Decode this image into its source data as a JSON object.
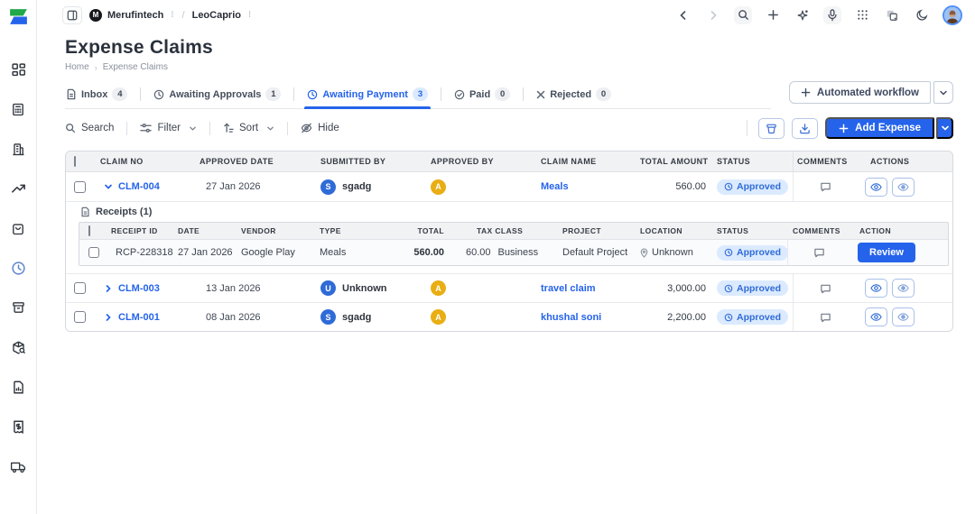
{
  "topbar": {
    "org_name": "Merufintech",
    "path_separator": "/",
    "project_name": "LeoCaprio"
  },
  "page": {
    "title": "Expense Claims",
    "breadcrumb_home": "Home",
    "breadcrumb_current": "Expense Claims"
  },
  "tabs": [
    {
      "label": "Inbox",
      "count": "4"
    },
    {
      "label": "Awaiting Approvals",
      "count": "1"
    },
    {
      "label": "Awaiting Payment",
      "count": "3"
    },
    {
      "label": "Paid",
      "count": "0"
    },
    {
      "label": "Rejected",
      "count": "0"
    }
  ],
  "workflow_button": {
    "label": "Automated workflow"
  },
  "toolbar": {
    "search_label": "Search",
    "filter_label": "Filter",
    "sort_label": "Sort",
    "hide_label": "Hide",
    "add_expense_label": "Add Expense"
  },
  "table": {
    "headers": [
      "CLAIM NO",
      "APPROVED DATE",
      "SUBMITTED BY",
      "APPROVED BY",
      "CLAIM NAME",
      "TOTAL AMOUNT",
      "STATUS",
      "COMMENTS",
      "ACTIONS"
    ],
    "rows": [
      {
        "claim_no": "CLM-004",
        "approved_date": "27 Jan 2026",
        "submitted_by_initial": "S",
        "submitted_by": "sgadg",
        "approved_by_initial": "A",
        "claim_name": "Meals",
        "total_amount": "560.00",
        "status": "Approved"
      },
      {
        "claim_no": "CLM-003",
        "approved_date": "13 Jan 2026",
        "submitted_by_initial": "U",
        "submitted_by": "Unknown",
        "approved_by_initial": "A",
        "claim_name": "travel claim",
        "total_amount": "3,000.00",
        "status": "Approved"
      },
      {
        "claim_no": "CLM-001",
        "approved_date": "08 Jan 2026",
        "submitted_by_initial": "S",
        "submitted_by": "sgadg",
        "approved_by_initial": "A",
        "claim_name": "khushal soni",
        "total_amount": "2,200.00",
        "status": "Approved"
      }
    ]
  },
  "receipts": {
    "title": "Receipts (1)",
    "headers": [
      "RECEIPT ID",
      "DATE",
      "VENDOR",
      "TYPE",
      "TOTAL",
      "TAX CLASS",
      "PROJECT",
      "LOCATION",
      "STATUS",
      "COMMENTS",
      "ACTION"
    ],
    "rows": [
      {
        "receipt_id": "RCP-228318",
        "date": "27 Jan 2026",
        "vendor": "Google Play",
        "type": "Meals",
        "total": "560.00",
        "tax": "60.00",
        "tax_class": "Business",
        "project": "Default Project",
        "location": "Unknown",
        "status": "Approved",
        "action_label": "Review"
      }
    ]
  },
  "colors": {
    "accent_blue": "#2563eb",
    "badge_bg": "#dbeafe",
    "avatar_blue": "#2f6bd7",
    "avatar_amber": "#e9ae13"
  }
}
